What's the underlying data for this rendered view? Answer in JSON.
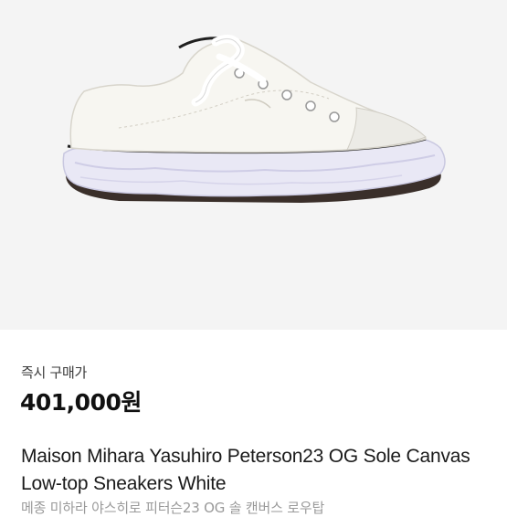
{
  "product": {
    "image_alt": "white canvas low-top sneaker",
    "price_caption": "즉시 구매가",
    "price": "401,000원",
    "title": "Maison Mihara Yasuhiro Peterson23 OG Sole Canvas Low-top Sneakers White",
    "subtitle": "메종 미하라 야스히로 피터슨23 OG 솔 캔버스 로우탑"
  },
  "colors": {
    "image_background": "#f4f4f4",
    "price_text": "#111111",
    "subtitle_text": "#9a9a9a"
  }
}
